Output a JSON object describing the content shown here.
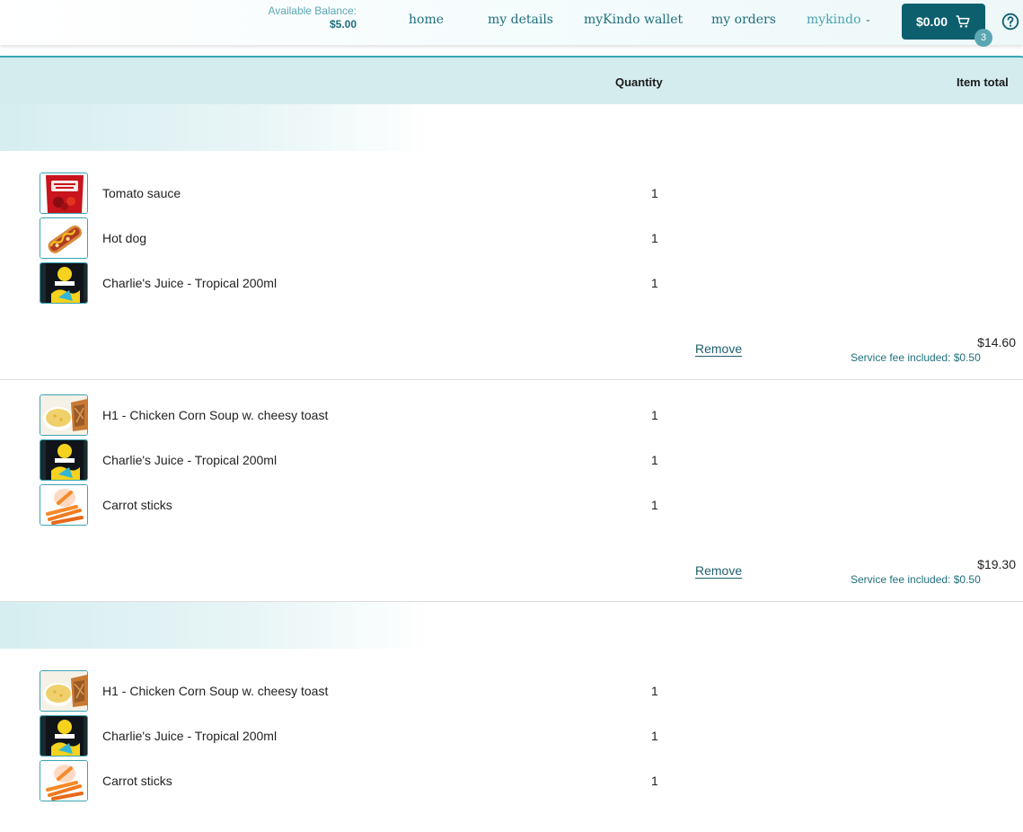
{
  "header": {
    "balance_label": "Available Balance:",
    "balance_value": "$5.00",
    "nav": {
      "home": "home",
      "details": "my details",
      "wallet": "myKindo wallet",
      "orders": "my orders",
      "mykindo": "mykindo"
    },
    "cart_amount": "$0.00",
    "cart_count": "3",
    "icons": [
      "cart-icon",
      "help-icon",
      "chevron-down-icon"
    ]
  },
  "table": {
    "quantity_label": "Quantity",
    "total_label": "Item total"
  },
  "orders": [
    {
      "items": [
        {
          "name": "Tomato sauce",
          "qty": "1",
          "image": "tomato-sauce-image"
        },
        {
          "name": "Hot dog",
          "qty": "1",
          "image": "hot-dog-image"
        },
        {
          "name": "Charlie's Juice - Tropical 200ml",
          "qty": "1",
          "image": "juice-image"
        }
      ],
      "remove_label": "Remove",
      "total": "$14.60",
      "service_fee": "Service fee included: $0.50"
    },
    {
      "items": [
        {
          "name": "H1 - Chicken Corn Soup w. cheesy toast",
          "qty": "1",
          "image": "soup-image"
        },
        {
          "name": "Charlie's Juice - Tropical 200ml",
          "qty": "1",
          "image": "juice-image"
        },
        {
          "name": "Carrot sticks",
          "qty": "1",
          "image": "carrot-sticks-image"
        }
      ],
      "remove_label": "Remove",
      "total": "$19.30",
      "service_fee": "Service fee included: $0.50"
    },
    {
      "items": [
        {
          "name": "H1 - Chicken Corn Soup w. cheesy toast",
          "qty": "1",
          "image": "soup-image"
        },
        {
          "name": "Charlie's Juice - Tropical 200ml",
          "qty": "1",
          "image": "juice-image"
        },
        {
          "name": "Carrot sticks",
          "qty": "1",
          "image": "carrot-sticks-image"
        }
      ]
    }
  ],
  "colors": {
    "brand_dark": "#0d5f6e",
    "brand_text": "#1f6f7c",
    "accent_light": "#5aa6b3",
    "header_bg": "#d4ecee"
  }
}
